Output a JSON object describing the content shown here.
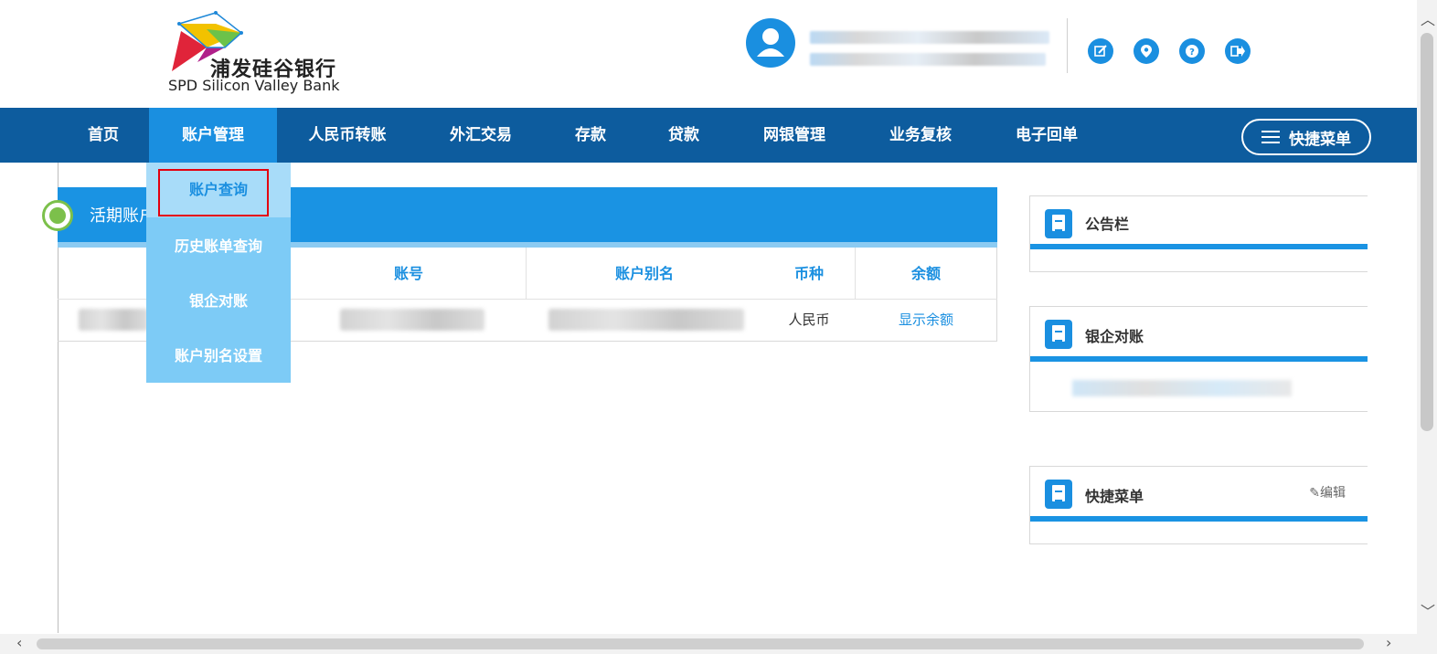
{
  "brand": {
    "name_cn": "浦发硅谷银行",
    "name_en": "SPD Silicon Valley Bank"
  },
  "header_icons": [
    "edit-icon",
    "location-icon",
    "help-icon",
    "logout-icon"
  ],
  "nav": {
    "items": [
      "首页",
      "账户管理",
      "人民币转账",
      "外汇交易",
      "存款",
      "贷款",
      "网银管理",
      "业务复核",
      "电子回单"
    ],
    "active": "账户管理",
    "quick_menu": "快捷菜单"
  },
  "dropdown": {
    "items": [
      "账户查询",
      "历史账单查询",
      "银企对账",
      "账户别名设置"
    ],
    "highlighted": "账户查询"
  },
  "panel": {
    "title": "活期账户",
    "columns": [
      "账号",
      "账户别名",
      "币种",
      "余额"
    ],
    "row": {
      "currency": "人民币",
      "balance_link": "显示余额"
    }
  },
  "sidebar": {
    "cards": [
      {
        "title": "公告栏"
      },
      {
        "title": "银企对账"
      },
      {
        "title": "快捷菜单",
        "action": "编辑"
      }
    ]
  },
  "colors": {
    "nav_bg": "#0d5c9e",
    "accent": "#1a8fe0",
    "dropdown_bg": "#7dcbf6",
    "highlight_border": "#e3000f",
    "status_dot": "#7cc04b"
  }
}
